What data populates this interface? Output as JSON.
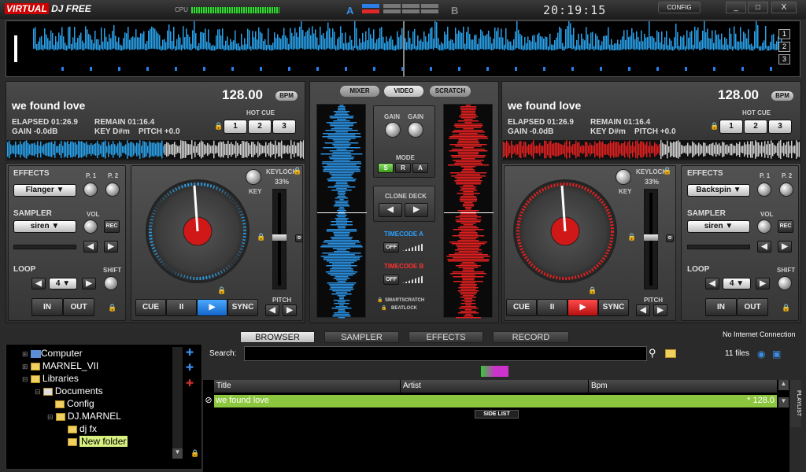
{
  "app": {
    "logo": "VIRTUAL DJ FREE",
    "logo_v": "VIRTUAL",
    "logo_rest": "DJ FREE",
    "cpu_label": "CPU",
    "deck_a": "A",
    "deck_b": "B",
    "clock": "20:19:15",
    "config": "CONFIG",
    "minimize": "_",
    "maximize": "□",
    "close": "X"
  },
  "overview": {
    "nums": [
      "1",
      "2",
      "3"
    ]
  },
  "deck_left": {
    "title": "we found love",
    "bpm": "128.00",
    "bpm_label": "BPM",
    "elapsed": "ELAPSED 01:26.9",
    "remain": "REMAIN 01:16.4",
    "gain": "GAIN -0.0dB",
    "key": "KEY D#m",
    "pitch": "PITCH +0.0",
    "hotcue_label": "HOT CUE",
    "hotcues": [
      "1",
      "2",
      "3"
    ],
    "effects_label": "EFFECTS",
    "effect": "Flanger",
    "p1": "P. 1",
    "p2": "P. 2",
    "sampler_label": "SAMPLER",
    "sample": "siren",
    "vol": "VOL",
    "rec": "REC",
    "loop_label": "LOOP",
    "loop_value": "4",
    "shift": "SHIFT",
    "in": "IN",
    "out": "OUT",
    "keylock": "KEYLOCK",
    "keylock_pct": "33%",
    "key_knob": "KEY",
    "pitch_label": "PITCH",
    "cue": "CUE",
    "pause": "II",
    "play": "▶",
    "sync": "SYNC"
  },
  "deck_right": {
    "title": "we found love",
    "bpm": "128.00",
    "bpm_label": "BPM",
    "elapsed": "ELAPSED 01:26.9",
    "remain": "REMAIN 01:16.4",
    "gain": "GAIN -0.0dB",
    "key": "KEY D#m",
    "pitch": "PITCH +0.0",
    "hotcue_label": "HOT CUE",
    "hotcues": [
      "1",
      "2",
      "3"
    ],
    "effects_label": "EFFECTS",
    "effect": "Backspin",
    "p1": "P. 1",
    "p2": "P. 2",
    "sampler_label": "SAMPLER",
    "sample": "siren",
    "vol": "VOL",
    "rec": "REC",
    "loop_label": "LOOP",
    "loop_value": "4",
    "shift": "SHIFT",
    "in": "IN",
    "out": "OUT",
    "keylock": "KEYLOCK",
    "keylock_pct": "33%",
    "key_knob": "KEY",
    "pitch_label": "PITCH",
    "cue": "CUE",
    "pause": "II",
    "play": "▶",
    "sync": "SYNC"
  },
  "center": {
    "tabs": [
      "MIXER",
      "VIDEO",
      "SCRATCH"
    ],
    "gain": "GAIN",
    "mode": "MODE",
    "modes": [
      "S",
      "R",
      "A"
    ],
    "clone_deck": "CLONE DECK",
    "timecode_a": "TIMECODE A",
    "timecode_b": "TIMECODE B",
    "off": "OFF",
    "smartscratch": "SMARTSCRATCH",
    "beatlock": "BEATLOCK"
  },
  "browser": {
    "tabs": [
      "BROWSER",
      "SAMPLER",
      "EFFECTS",
      "RECORD"
    ],
    "no_internet": "No Internet Connection",
    "search_label": "Search:",
    "search_value": "",
    "files": "11 files",
    "columns": [
      "Title",
      "Artist",
      "Bpm"
    ],
    "row": {
      "title": "we found love",
      "artist": "",
      "bpm": "* 128.0"
    },
    "side_list": "SIDE LIST",
    "playlist": "PLAYLIST",
    "tree": [
      "Computer",
      "MARNEL_VII",
      "Libraries",
      "Documents",
      "Config",
      "DJ.MARNEL",
      "dj fx",
      "New folder"
    ]
  },
  "colors": {
    "deck_a": "#2a9fe8",
    "deck_b": "#e02020",
    "accent_green": "#8cc63f"
  }
}
